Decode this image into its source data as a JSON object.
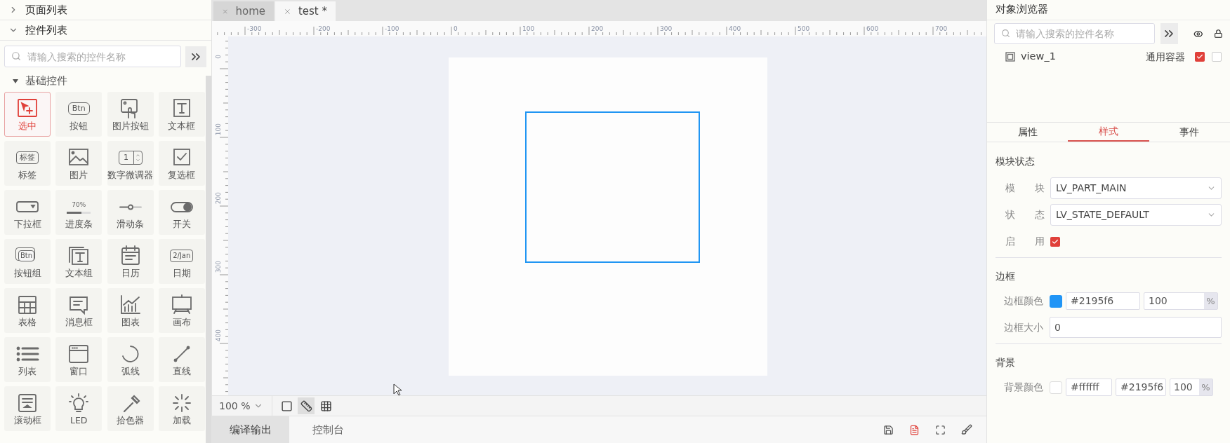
{
  "left_panel": {
    "sections": [
      {
        "title": "页面列表",
        "expanded": false
      },
      {
        "title": "控件列表",
        "expanded": true
      }
    ],
    "search": {
      "placeholder": "请输入搜索的控件名称"
    },
    "group": {
      "title": "基础控件",
      "expanded": true
    },
    "widgets": [
      {
        "kind": "select",
        "label": "选中",
        "selected": true
      },
      {
        "kind": "button",
        "label": "按钮",
        "icon_text": "Btn",
        "selected": false
      },
      {
        "kind": "imgbtn",
        "label": "图片按钮",
        "selected": false
      },
      {
        "kind": "textbox",
        "label": "文本框",
        "selected": false
      },
      {
        "kind": "label",
        "label": "标签",
        "icon_text": "标签",
        "selected": false
      },
      {
        "kind": "image",
        "label": "图片",
        "selected": false
      },
      {
        "kind": "spinbox",
        "label": "数字微调器",
        "icon_text": "1",
        "selected": false
      },
      {
        "kind": "checkbox",
        "label": "复选框",
        "selected": false
      },
      {
        "kind": "dropdown",
        "label": "下拉框",
        "selected": false
      },
      {
        "kind": "bar",
        "label": "进度条",
        "icon_text": "70%",
        "selected": false
      },
      {
        "kind": "slider",
        "label": "滑动条",
        "selected": false
      },
      {
        "kind": "switch",
        "label": "开关",
        "selected": false
      },
      {
        "kind": "btnmatrix",
        "label": "按钮组",
        "icon_text": "Btn",
        "selected": false
      },
      {
        "kind": "textarea",
        "label": "文本组",
        "selected": false
      },
      {
        "kind": "calendar",
        "label": "日历",
        "selected": false
      },
      {
        "kind": "date",
        "label": "日期",
        "icon_text": "2/Jan",
        "selected": false
      },
      {
        "kind": "table",
        "label": "表格",
        "selected": false
      },
      {
        "kind": "msgbox",
        "label": "消息框",
        "selected": false
      },
      {
        "kind": "chart",
        "label": "图表",
        "selected": false
      },
      {
        "kind": "canvas",
        "label": "画布",
        "selected": false
      },
      {
        "kind": "list",
        "label": "列表",
        "selected": false
      },
      {
        "kind": "window",
        "label": "窗口",
        "selected": false
      },
      {
        "kind": "arc",
        "label": "弧线",
        "selected": false
      },
      {
        "kind": "line",
        "label": "直线",
        "selected": false
      },
      {
        "kind": "roller",
        "label": "滚动框",
        "selected": false
      },
      {
        "kind": "led",
        "label": "LED",
        "selected": false
      },
      {
        "kind": "colorpicker",
        "label": "拾色器",
        "selected": false
      },
      {
        "kind": "spinner",
        "label": "加载",
        "selected": false
      }
    ]
  },
  "editor_tabs": [
    {
      "label": "home",
      "selected": false
    },
    {
      "label": "test *",
      "selected": true
    }
  ],
  "ruler": {
    "x_labels": [
      "-300",
      "-200",
      "-100",
      "0",
      "100",
      "200",
      "300",
      "400",
      "500",
      "600",
      "700"
    ],
    "y_labels": [
      "0",
      "100",
      "200",
      "300",
      "400"
    ]
  },
  "toolbar": {
    "zoom": "100 %",
    "views": [
      {
        "kind": "frame",
        "selected": false
      },
      {
        "kind": "ruler",
        "selected": true
      },
      {
        "kind": "grid",
        "selected": false
      }
    ]
  },
  "bottom_tabs": [
    {
      "label": "编译输出",
      "selected": true
    },
    {
      "label": "控制台",
      "selected": false
    }
  ],
  "bottom_actions": [
    {
      "kind": "save"
    },
    {
      "kind": "document"
    },
    {
      "kind": "fullscreen"
    },
    {
      "kind": "clear"
    }
  ],
  "object_browser": {
    "title": "对象浏览器",
    "search": {
      "placeholder": "请输入搜索的控件名称"
    },
    "items": [
      {
        "name": "view_1",
        "type": "通用容器",
        "visible": true,
        "locked": false
      }
    ]
  },
  "prop_tabs": [
    {
      "label": "属性",
      "selected": false
    },
    {
      "label": "样式",
      "selected": true
    },
    {
      "label": "事件",
      "selected": false
    }
  ],
  "module_state": {
    "title": "模块状态",
    "part_label": [
      "模",
      "块"
    ],
    "part": "LV_PART_MAIN",
    "state_label": [
      "状",
      "态"
    ],
    "state": "LV_STATE_DEFAULT",
    "enable_label": [
      "启",
      "用"
    ],
    "enabled": true
  },
  "border": {
    "title": "边框",
    "color_label": "边框颜色",
    "color": "#2195f6",
    "color_text": "#2195f6",
    "opacity": "100",
    "percent": "%",
    "size_label": "边框大小",
    "size": "0"
  },
  "background": {
    "title": "背景",
    "color_label": "背景颜色",
    "color": "#ffffff",
    "color_text": "#ffffff",
    "grad_color": "#2195f6",
    "opacity": "100",
    "percent": "%"
  }
}
